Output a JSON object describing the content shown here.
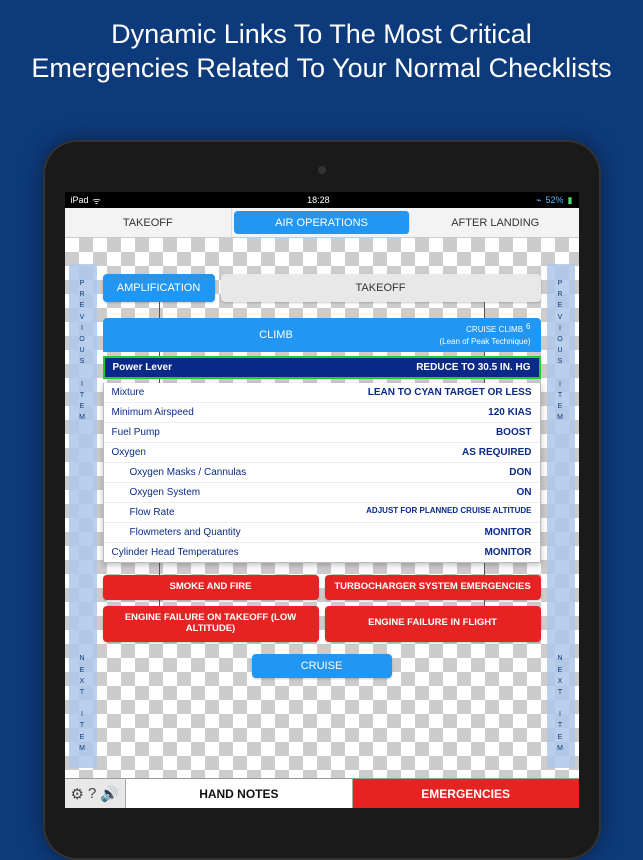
{
  "promo": {
    "title": "Dynamic Links To The Most Critical Emergencies Related To Your Normal Checklists"
  },
  "status": {
    "device": "iPad",
    "wifi": "◉",
    "time": "18:28",
    "bt": "✱",
    "battery": "52%"
  },
  "tabs": {
    "left": "TAKEOFF",
    "center": "AIR OPERATIONS",
    "right": "AFTER LANDING"
  },
  "rail": {
    "prev": "PREVIOUS ITEM",
    "next": "NEXT ITEM"
  },
  "buttons": {
    "amplification": "AMPLIFICATION",
    "takeoff": "TAKEOFF",
    "cruise": "CRUISE"
  },
  "climb": {
    "label": "CLIMB",
    "sub_title": "CRUISE CLIMB",
    "sub_paren": "(Lean of Peak Technique)",
    "badge": "6"
  },
  "current": {
    "label": "Power Lever",
    "value": "REDUCE TO 30.5 IN. HG"
  },
  "rows": [
    {
      "label": "Mixture",
      "value": "LEAN TO CYAN TARGET OR LESS",
      "indent": false,
      "sm": false
    },
    {
      "label": "Minimum Airspeed",
      "value": "120 KIAS",
      "indent": false,
      "sm": false
    },
    {
      "label": "Fuel Pump",
      "value": "BOOST",
      "indent": false,
      "sm": false
    },
    {
      "label": "Oxygen",
      "value": "AS REQUIRED",
      "indent": false,
      "sm": false
    },
    {
      "label": "Oxygen Masks / Cannulas",
      "value": "DON",
      "indent": true,
      "sm": false
    },
    {
      "label": "Oxygen System",
      "value": "ON",
      "indent": true,
      "sm": false
    },
    {
      "label": "Flow Rate",
      "value": "ADJUST FOR PLANNED CRUISE ALTITUDE",
      "indent": true,
      "sm": true
    },
    {
      "label": "Flowmeters and Quantity",
      "value": "MONITOR",
      "indent": true,
      "sm": false
    },
    {
      "label": "Cylinder Head Temperatures",
      "value": "MONITOR",
      "indent": false,
      "sm": false
    }
  ],
  "emergencies": {
    "a": "SMOKE AND FIRE",
    "b": "TURBOCHARGER SYSTEM EMERGENCIES",
    "c": "ENGINE FAILURE ON TAKEOFF (LOW ALTITUDE)",
    "d": "ENGINE FAILURE IN FLIGHT"
  },
  "bottom": {
    "hand_notes": "HAND NOTES",
    "emergencies": "EMERGENCIES"
  }
}
